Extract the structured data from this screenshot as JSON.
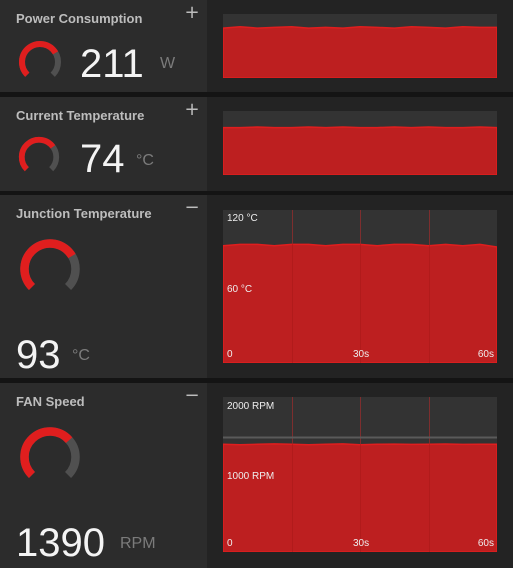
{
  "accent_color": "#e01e1e",
  "metrics": [
    {
      "title": "Power Consumption",
      "toggle": "+",
      "value": "211",
      "unit": "W",
      "level": 0.72
    },
    {
      "title": "Current Temperature",
      "toggle": "+",
      "value": "74",
      "unit": "°C",
      "level": 0.7
    },
    {
      "title": "Junction Temperature",
      "toggle": "−",
      "value": "93",
      "unit": "°C",
      "level": 0.72,
      "chart": {
        "y_top_label": "120 °C",
        "y_mid_label": "60 °C",
        "x_labels": [
          "0",
          "30s",
          "60s"
        ]
      }
    },
    {
      "title": "FAN Speed",
      "toggle": "−",
      "value": "1390",
      "unit": "RPM",
      "level": 0.68,
      "chart": {
        "y_top_label": "2000 RPM",
        "y_mid_label": "1000 RPM",
        "x_labels": [
          "0",
          "30s",
          "60s"
        ]
      }
    }
  ],
  "chart_data": [
    {
      "type": "area",
      "y_values_level": [
        0.78,
        0.8,
        0.78,
        0.79,
        0.8,
        0.78,
        0.79,
        0.78,
        0.8,
        0.79,
        0.78,
        0.8,
        0.79,
        0.78,
        0.8,
        0.79,
        0.79
      ]
    },
    {
      "type": "area",
      "y_values_level": [
        0.74,
        0.74,
        0.75,
        0.74,
        0.74,
        0.75,
        0.74,
        0.75,
        0.74,
        0.74,
        0.75,
        0.74,
        0.75,
        0.74,
        0.74,
        0.75,
        0.74
      ]
    },
    {
      "type": "area",
      "xlabel": "",
      "ylabel": "",
      "x_ticks": [
        "0",
        "30s",
        "60s"
      ],
      "ylim_c": [
        0,
        120
      ],
      "y_values": [
        92,
        93,
        93,
        92,
        93,
        93,
        92,
        93,
        93,
        92,
        93,
        93,
        92,
        93,
        92,
        93,
        91
      ]
    },
    {
      "type": "area",
      "xlabel": "",
      "ylabel": "",
      "x_ticks": [
        "0",
        "30s",
        "60s"
      ],
      "ylim_rpm": [
        0,
        2000
      ],
      "y_values": [
        1390,
        1385,
        1390,
        1395,
        1390,
        1385,
        1390,
        1395,
        1385,
        1390,
        1392,
        1388,
        1390,
        1393,
        1388,
        1390,
        1390
      ]
    }
  ]
}
